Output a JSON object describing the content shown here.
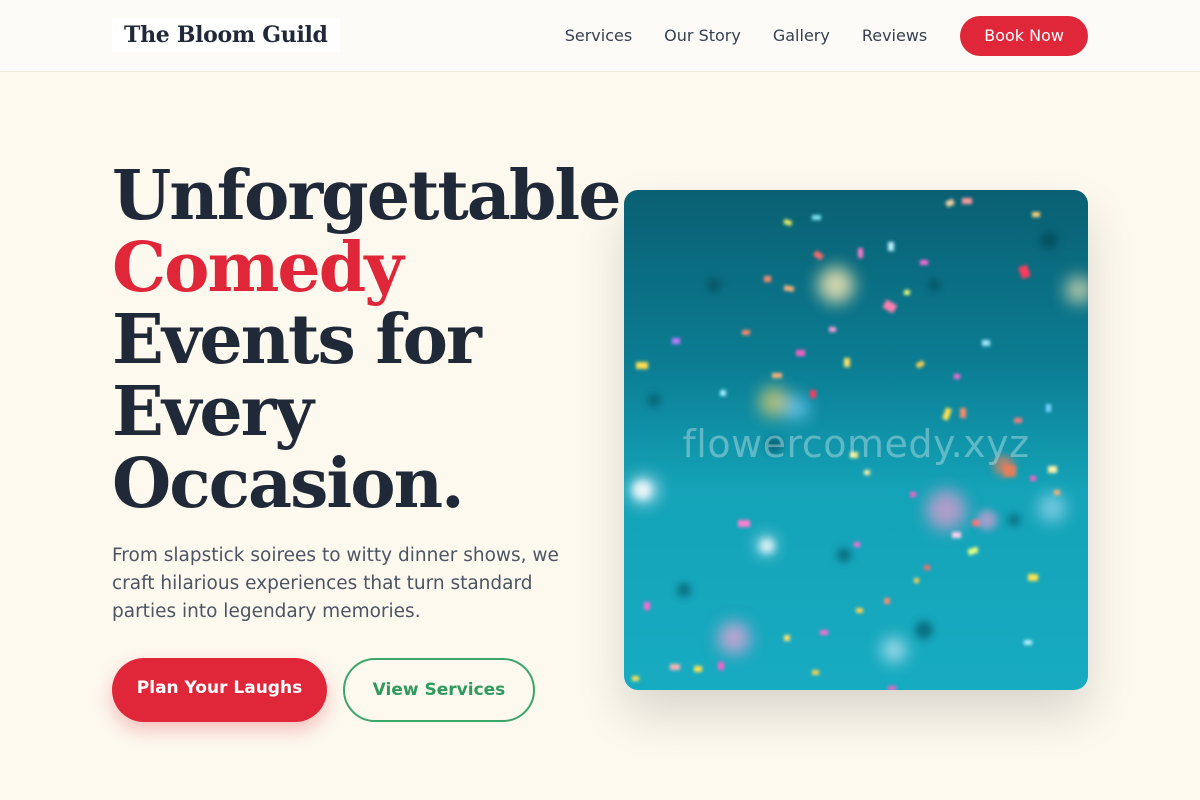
{
  "header": {
    "logo": "The Bloom Guild",
    "nav": [
      "Services",
      "Our Story",
      "Gallery",
      "Reviews"
    ],
    "cta": "Book Now"
  },
  "hero": {
    "headline": {
      "line1": "Unforgettable",
      "line2": "Comedy",
      "line3": "Events for",
      "line4": "Every",
      "line5": "Occasion."
    },
    "subtext": "From slapstick soirees to witty dinner shows, we craft hilarious experiences that turn standard parties into legendary memories.",
    "primary_button": "Plan Your Laughs",
    "secondary_button": "View Services",
    "image_watermark": "flowercomedy.xyz"
  },
  "colors": {
    "accent": "#e0273a",
    "secondary": "#3aa66a",
    "background": "#fdf9ef",
    "text": "#1f2937"
  }
}
